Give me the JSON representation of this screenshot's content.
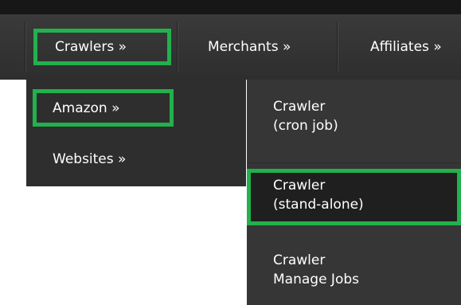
{
  "nav": {
    "items": [
      {
        "label": "Crawlers »"
      },
      {
        "label": "Merchants »"
      },
      {
        "label": "Affiliates »"
      }
    ]
  },
  "crawlers_menu": {
    "items": [
      {
        "label": "Amazon »"
      },
      {
        "label": "Websites »"
      }
    ]
  },
  "amazon_menu": {
    "items": [
      {
        "line1": "Crawler",
        "line2": "(cron job)"
      },
      {
        "line1": "Crawler",
        "line2": "(stand-alone)"
      },
      {
        "line1": "Crawler",
        "line2": "Manage Jobs"
      }
    ]
  },
  "colors": {
    "highlight": "#22b14c",
    "bar": "#2e2e2e",
    "submenu": "#363636",
    "text": "#ffffff"
  }
}
